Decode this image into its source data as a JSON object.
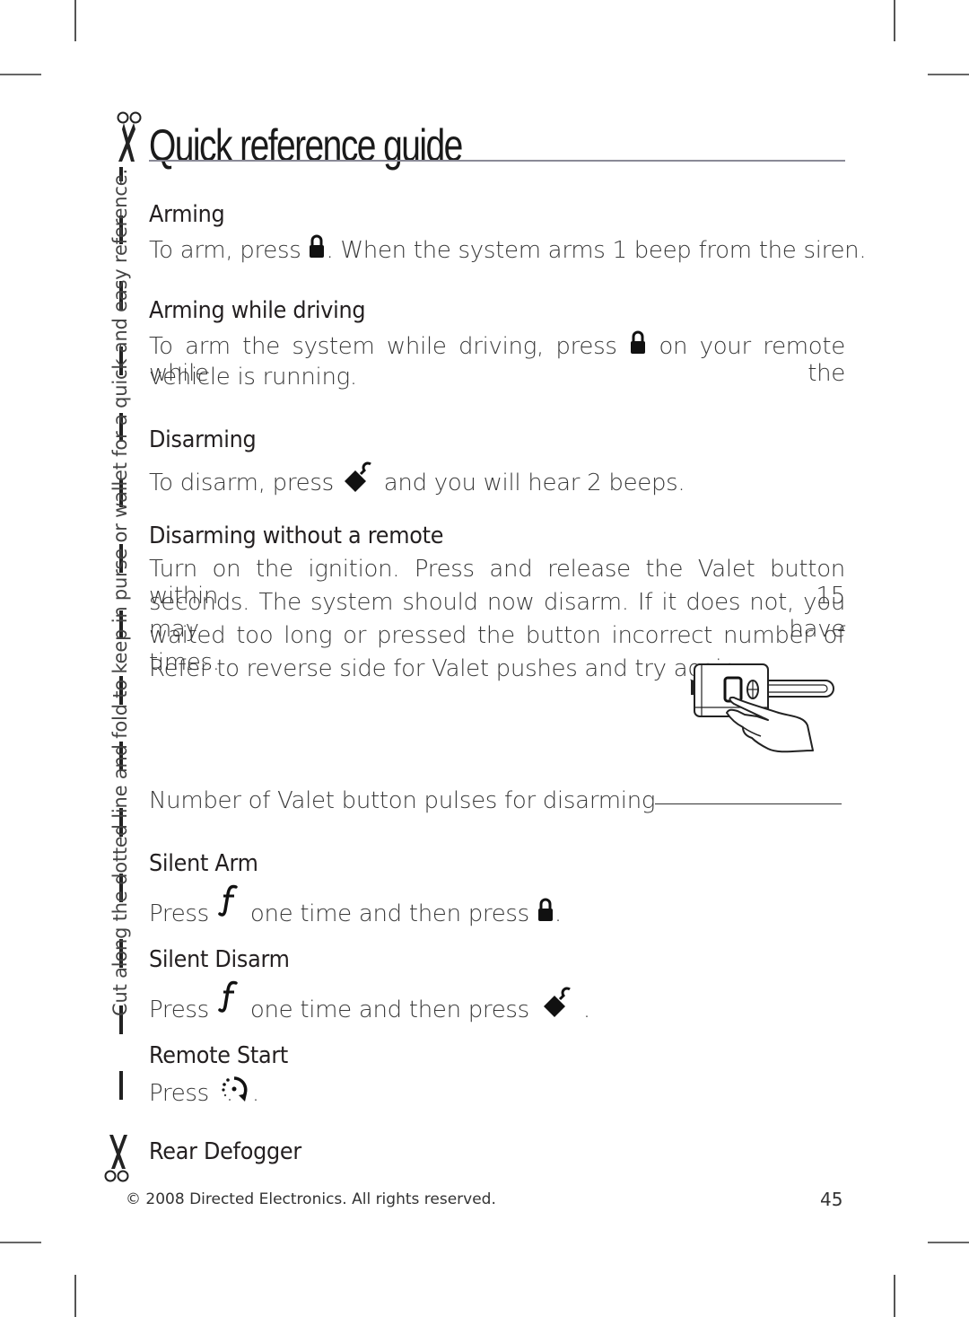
{
  "page": {
    "title": "Quick reference guide",
    "side_instruction": "Cut along the dotted line and fold to keep in purse or wallet for a quick and easy reference.",
    "icons": {
      "scissors": "scissors-icon",
      "lock": "lock-icon",
      "unlock": "unlock-icon",
      "function": "function-f-icon",
      "remote_start": "remote-start-icon",
      "valet_remote": "valet-button-illustration"
    }
  },
  "sections": {
    "arming": {
      "heading": "Arming",
      "text_before": "To arm, press ",
      "text_after": ". When the system arms 1 beep from the siren."
    },
    "arming_driving": {
      "heading": "Arming while driving",
      "line1_before": "To arm the system while driving, press ",
      "line1_after": " on your remote while the",
      "line2": "vehicle is running."
    },
    "disarming": {
      "heading": "Disarming",
      "text_before": "To disarm, press ",
      "text_after": " and you will hear 2 beeps."
    },
    "disarming_no_remote": {
      "heading": "Disarming without a remote",
      "line1": "Turn on the ignition. Press and release the Valet button within 15",
      "line2": "seconds. The system should now disarm. If it does not, you may have",
      "line3": "waited too long or pressed the button incorrect number of times.",
      "line4": "Refer to reverse side for Valet pushes and try again."
    },
    "valet_pulses": {
      "label": "Number of Valet button pulses for disarming",
      "value": ""
    },
    "silent_arm": {
      "heading": "Silent Arm",
      "press": "Press ",
      "middle": " one time and then press ",
      "end": "."
    },
    "silent_disarm": {
      "heading": "Silent Disarm",
      "press": "Press ",
      "middle": " one time and then press ",
      "end": "."
    },
    "remote_start": {
      "heading": "Remote Start",
      "press": "Press ",
      "end": "."
    },
    "rear_defogger": {
      "heading": "Rear Defogger"
    }
  },
  "footer": {
    "copyright": "© 2008 Directed Electronics. All rights reserved.",
    "page_number": "45"
  }
}
